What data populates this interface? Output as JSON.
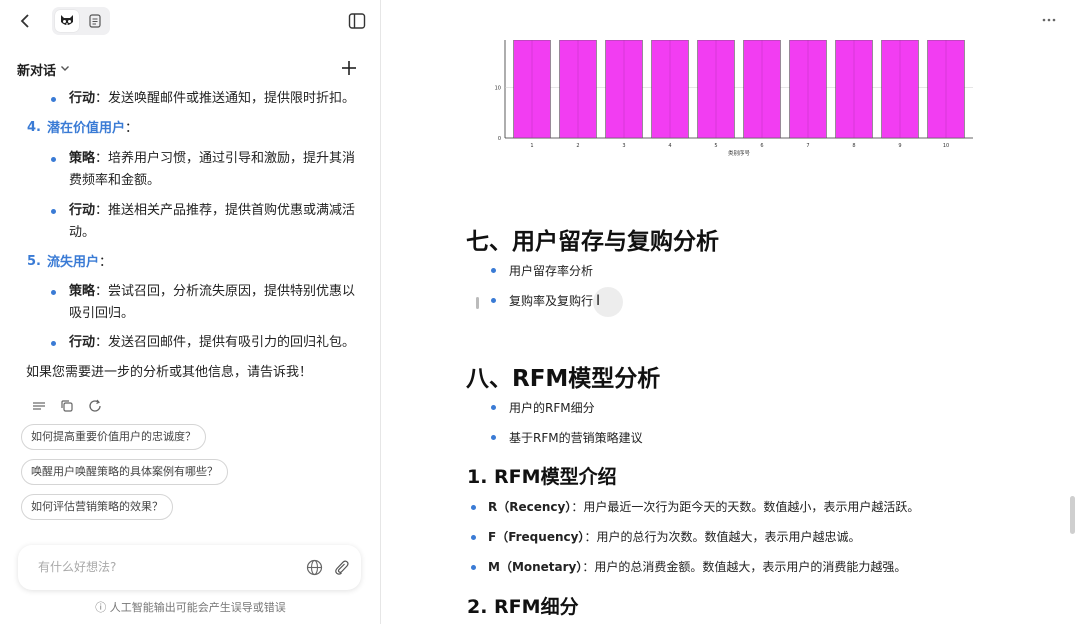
{
  "left": {
    "conv_title": "新对话",
    "items": [
      {
        "label": "行动",
        "text": "：发送唤醒邮件或推送通知，提供限时折扣。"
      },
      {
        "num": "4.",
        "title": "潜在价值用户",
        "colon": "："
      },
      {
        "label": "策略",
        "line1": "：培养用户习惯，通过引导和激励，提升其消",
        "line2": "费频率和金额。"
      },
      {
        "label": "行动",
        "line1": "：推送相关产品推荐，提供首购优惠或满减活",
        "line2": "动。"
      },
      {
        "num": "5.",
        "title": "流失用户",
        "colon": "："
      },
      {
        "label": "策略",
        "line1": "：尝试召回，分析流失原因，提供特别优惠以",
        "line2": "吸引回归。"
      },
      {
        "label": "行动",
        "text": "：发送召回邮件，提供有吸引力的回归礼包。"
      }
    ],
    "closing": "如果您需要进一步的分析或其他信息，请告诉我！",
    "suggestions": [
      "如何提高重要价值用户的忠诚度？",
      "唤醒用户唤醒策略的具体案例有哪些？",
      "如何评估营销策略的效果？"
    ],
    "input_placeholder": "有什么好想法?",
    "disclaimer": "ⓘ 人工智能输出可能会产生误导或错误"
  },
  "right": {
    "sec7_title": "七、用户留存与复购分析",
    "sec7_items": [
      "用户留存率分析",
      "复购率及复购行"
    ],
    "sec8_title": "八、RFM模型分析",
    "sec8_items": [
      "用户的RFM细分",
      "基于RFM的营销策略建议"
    ],
    "h3_1": "1. RFM模型介绍",
    "rfm_items": [
      {
        "label": "R（Recency）",
        "text": "：用户最近一次行为距今天的天数。数值越小，表示用户越活跃。"
      },
      {
        "label": "F（Frequency）",
        "text": "：用户的总行为次数。数值越大，表示用户越忠诚。"
      },
      {
        "label": "M（Monetary）",
        "text": "：用户的总消费金额。数值越大，表示用户的消费能力越强。"
      }
    ],
    "h3_2": "2. RFM细分"
  },
  "chart_data": {
    "type": "bar",
    "categories": [
      "1",
      "2",
      "3",
      "4",
      "5",
      "6",
      "7",
      "8",
      "9",
      "10"
    ],
    "values": [
      19.5,
      19.5,
      19.5,
      19.5,
      19.5,
      19.5,
      19.5,
      19.5,
      19.5,
      19.5
    ],
    "xlabel": "类别序号",
    "ylabel": "",
    "yticks": [
      "0",
      "10"
    ],
    "ylim": [
      0,
      19.5
    ],
    "bar_color": "#f23df2",
    "grid": true
  },
  "colors": {
    "accent": "#3a7bd5",
    "bar": "#f23df2"
  }
}
